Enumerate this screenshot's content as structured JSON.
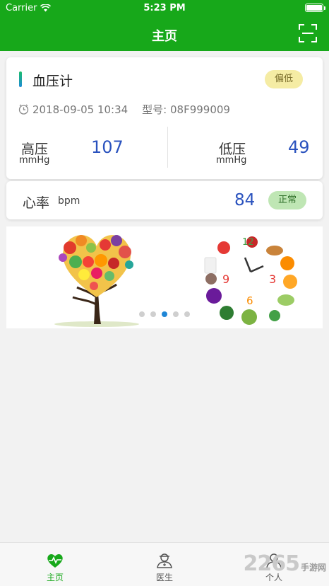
{
  "status_bar": {
    "carrier": "Carrier",
    "time": "5:23 PM"
  },
  "nav": {
    "title": "主页",
    "scan_icon": "scan-icon"
  },
  "bp_card": {
    "title": "血压计",
    "status_badge": "偏低",
    "datetime": "2018-09-05 10:34",
    "model": "型号: 08F999009",
    "high": {
      "label": "高压",
      "unit": "mmHg",
      "value": "107"
    },
    "low": {
      "label": "低压",
      "unit": "mmHg",
      "value": "49"
    }
  },
  "hr_card": {
    "label": "心率",
    "unit": "bpm",
    "value": "84",
    "status_badge": "正常"
  },
  "banner": {
    "slides": [
      "heart-fruit-tree-image",
      "fruit-clock-image"
    ],
    "total_pages": 5,
    "active_index": 2
  },
  "tabbar": {
    "items": [
      {
        "label": "主页",
        "icon": "heart-pulse-icon"
      },
      {
        "label": "医生",
        "icon": "doctor-icon"
      },
      {
        "label": "个人",
        "icon": "person-icon"
      }
    ]
  },
  "watermark": {
    "text": "2265",
    "sub": "手游网"
  },
  "colors": {
    "brand_green": "#17a81a",
    "value_blue": "#2a52be",
    "badge_low_bg": "#f5eca4",
    "badge_ok_bg": "#bfe6b4"
  }
}
